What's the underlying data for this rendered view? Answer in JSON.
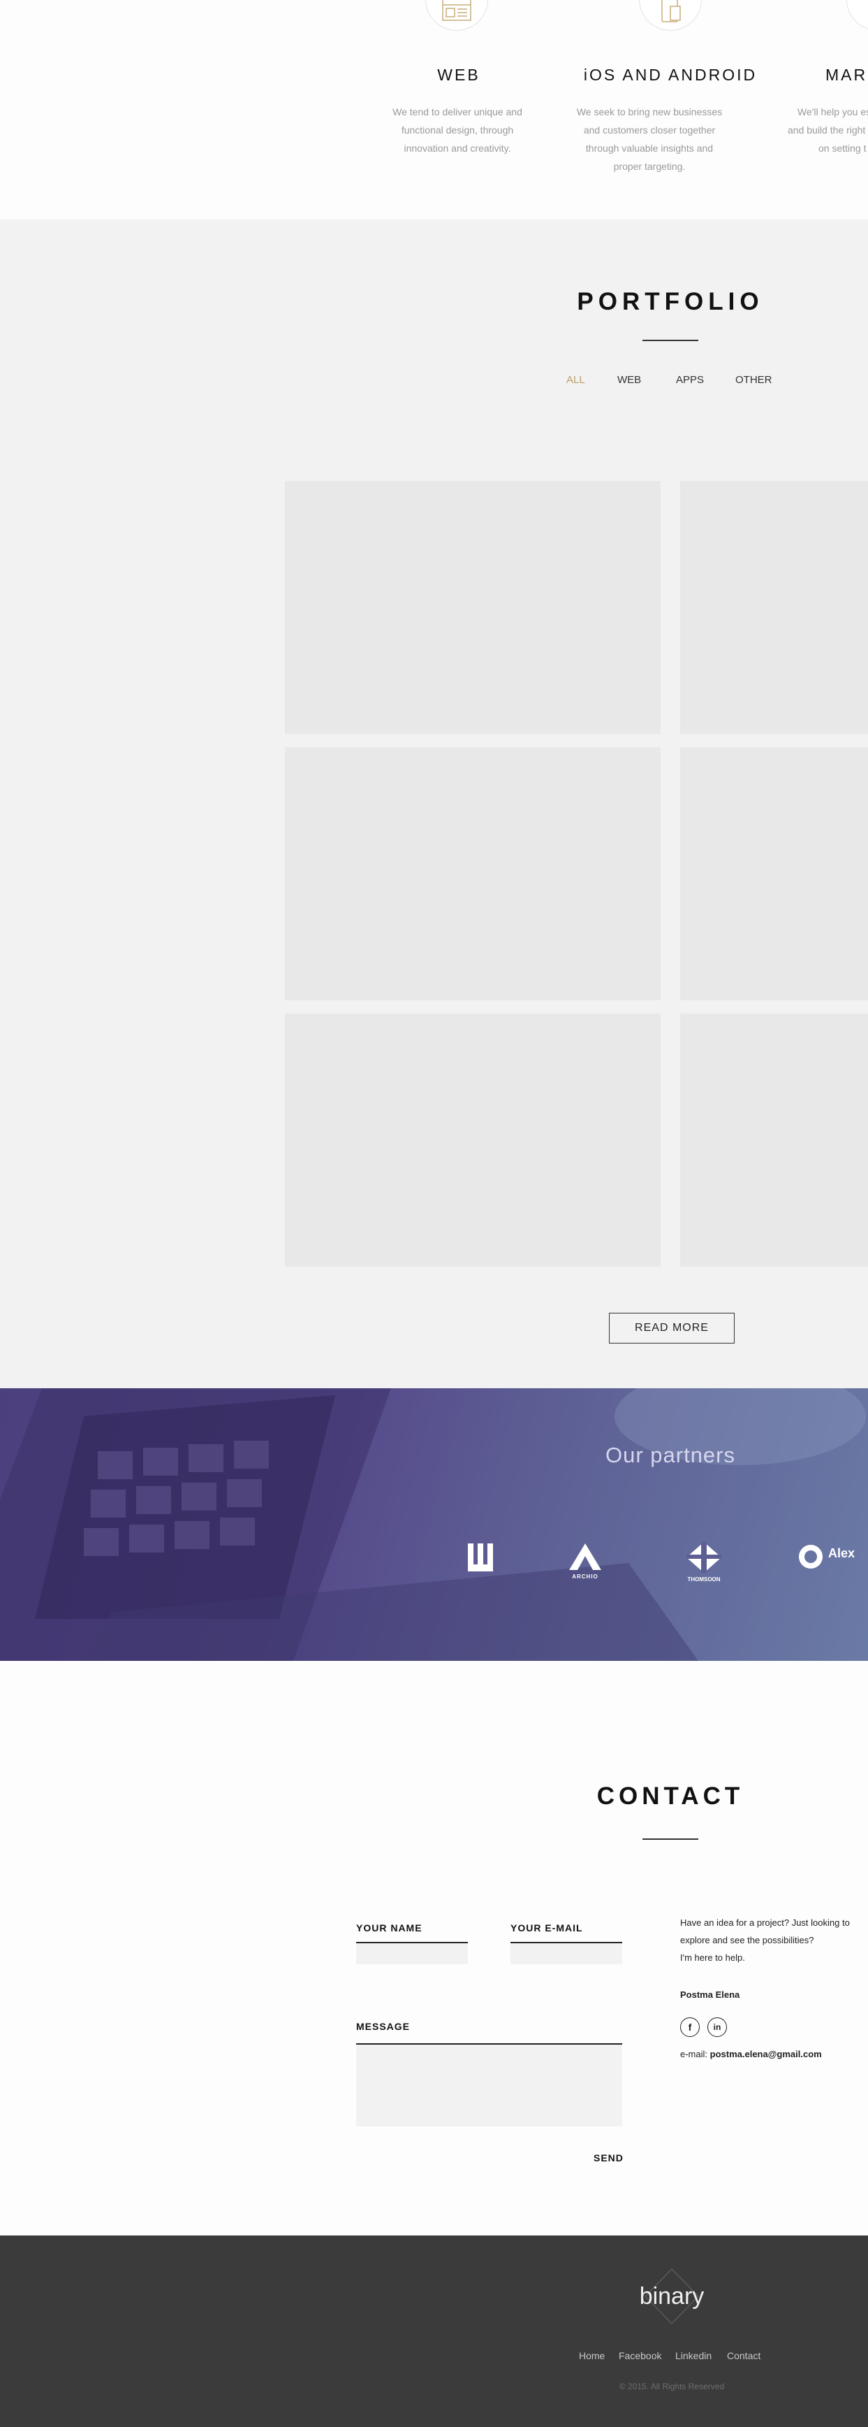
{
  "services": [
    {
      "icon": "layout-icon",
      "title": "WEB",
      "description": "We tend to deliver unique and functional design, through innovation and creativity."
    },
    {
      "icon": "mobile-icon",
      "title": "iOS AND ANDROID",
      "description": "We seek to bring new businesses and customers closer together through valuable insights and proper targeting."
    },
    {
      "icon": "marketing-icon",
      "title": "MAR",
      "description": "We'll help you es and build the right on setting t"
    }
  ],
  "portfolio": {
    "title": "PORTFOLIO",
    "filters": [
      "ALL",
      "WEB",
      "APPS",
      "OTHER"
    ],
    "active_filter": "ALL",
    "read_more": "READ MORE"
  },
  "partners": {
    "title": "Our partners",
    "logos": [
      {
        "name": "w-logo",
        "text": ""
      },
      {
        "name": "archio-logo",
        "text": "ARCHIO"
      },
      {
        "name": "thomsoon-logo",
        "text": "THOMSOON"
      },
      {
        "name": "alex-logo",
        "text": "Alex"
      }
    ]
  },
  "contact": {
    "title": "CONTACT",
    "name_label": "YOUR NAME",
    "email_label": "YOUR E-MAIL",
    "message_label": "MESSAGE",
    "send": "SEND",
    "intro_line1": "Have an idea for a project? Just looking to",
    "intro_line2": "explore and see the possibilities?",
    "intro_line3": "I'm here to help.",
    "person": "Postma Elena",
    "social": [
      {
        "icon": "facebook-icon",
        "glyph": "f"
      },
      {
        "icon": "linkedin-icon",
        "glyph": "in"
      }
    ],
    "email_prefix": "e-mail:",
    "email": "postma.elena@gmail.com"
  },
  "footer": {
    "brand": "binary",
    "nav": [
      "Home",
      "Facebook",
      "Linkedin",
      "Contact"
    ],
    "copyright": "© 2015. All Rights Reserved"
  },
  "colors": {
    "accent": "#b9a06a",
    "footer_bg": "#3b3b3b",
    "portfolio_bg": "#f2f2f2",
    "partners_overlay": "#55488a"
  }
}
